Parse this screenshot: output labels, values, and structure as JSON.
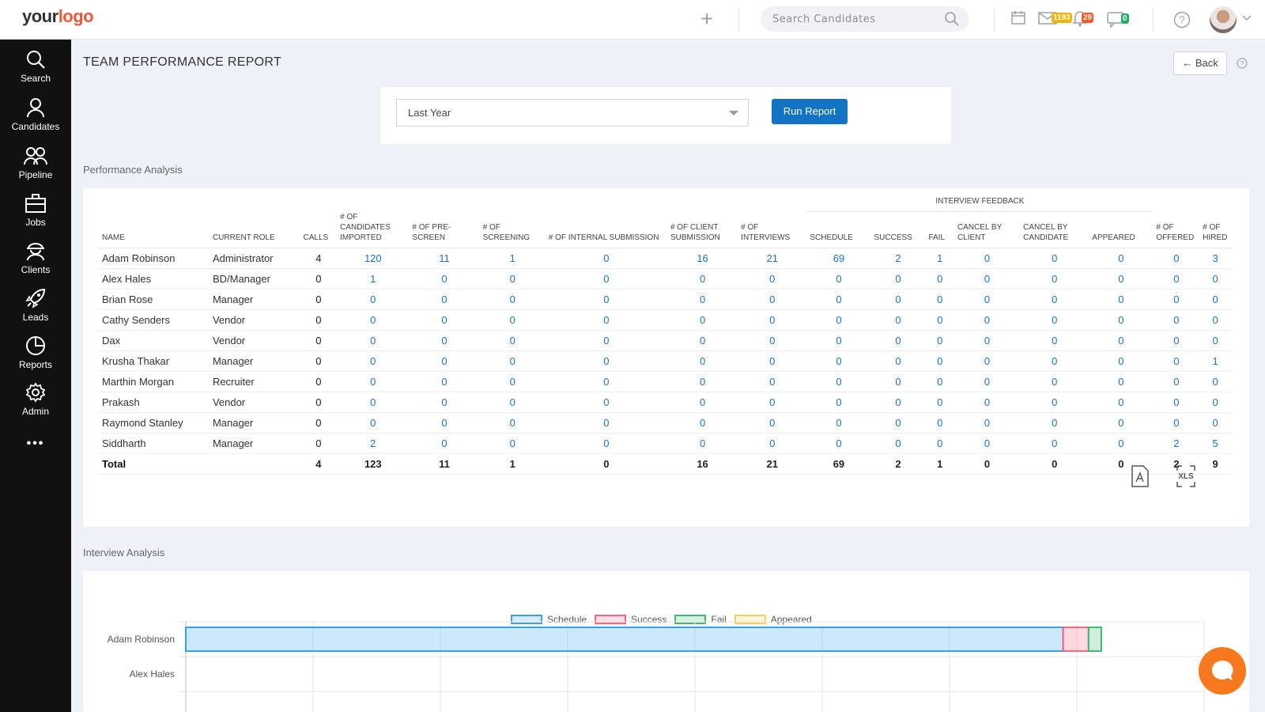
{
  "header": {
    "logo_part1": "your",
    "logo_part2": "logo",
    "search_placeholder": "Search Candidates",
    "mail_badge": "1193",
    "bell_badge": "29",
    "chat_badge": "0",
    "badge_colors": {
      "mail": "#f0b400",
      "bell": "#ff5722",
      "chat": "#27ae60"
    }
  },
  "sidebar": {
    "items": [
      {
        "label": "Search",
        "icon": "search-icon"
      },
      {
        "label": "Candidates",
        "icon": "user-icon"
      },
      {
        "label": "Pipeline",
        "icon": "users-icon"
      },
      {
        "label": "Jobs",
        "icon": "briefcase-icon"
      },
      {
        "label": "Clients",
        "icon": "client-icon"
      },
      {
        "label": "Leads",
        "icon": "rocket-icon"
      },
      {
        "label": "Reports",
        "icon": "pie-chart-icon"
      },
      {
        "label": "Admin",
        "icon": "gear-icon"
      }
    ],
    "more": "•••"
  },
  "page": {
    "title": "TEAM PERFORMANCE REPORT",
    "back_label": "← Back"
  },
  "filter": {
    "period": "Last Year",
    "run_label": "Run Report"
  },
  "performance": {
    "section_label": "Performance Analysis",
    "group_header": "INTERVIEW FEEDBACK",
    "columns": [
      "NAME",
      "CURRENT ROLE",
      "CALLS",
      "# OF CANDIDATES IMPORTED",
      "# OF PRE-SCREEN",
      "# OF SCREENING",
      "# OF INTERNAL SUBMISSION",
      "# OF CLIENT SUBMISSION",
      "# OF INTERVIEWS",
      "SCHEDULE",
      "SUCCESS",
      "FAIL",
      "CANCEL BY CLIENT",
      "CANCEL BY CANDIDATE",
      "APPEARED",
      "# OF OFFERED",
      "# OF HIRED"
    ],
    "rows": [
      [
        "Adam Robinson",
        "Administrator",
        "4",
        "120",
        "11",
        "1",
        "0",
        "16",
        "21",
        "69",
        "2",
        "1",
        "0",
        "0",
        "0",
        "0",
        "3"
      ],
      [
        "Alex Hales",
        "BD/Manager",
        "0",
        "1",
        "0",
        "0",
        "0",
        "0",
        "0",
        "0",
        "0",
        "0",
        "0",
        "0",
        "0",
        "0",
        "0"
      ],
      [
        "Brian Rose",
        "Manager",
        "0",
        "0",
        "0",
        "0",
        "0",
        "0",
        "0",
        "0",
        "0",
        "0",
        "0",
        "0",
        "0",
        "0",
        "0"
      ],
      [
        "Cathy Senders",
        "Vendor",
        "0",
        "0",
        "0",
        "0",
        "0",
        "0",
        "0",
        "0",
        "0",
        "0",
        "0",
        "0",
        "0",
        "0",
        "0"
      ],
      [
        "Dax",
        "Vendor",
        "0",
        "0",
        "0",
        "0",
        "0",
        "0",
        "0",
        "0",
        "0",
        "0",
        "0",
        "0",
        "0",
        "0",
        "0"
      ],
      [
        "Krusha Thakar",
        "Manager",
        "0",
        "0",
        "0",
        "0",
        "0",
        "0",
        "0",
        "0",
        "0",
        "0",
        "0",
        "0",
        "0",
        "0",
        "1"
      ],
      [
        "Marthin Morgan",
        "Recruiter",
        "0",
        "0",
        "0",
        "0",
        "0",
        "0",
        "0",
        "0",
        "0",
        "0",
        "0",
        "0",
        "0",
        "0",
        "0"
      ],
      [
        "Prakash",
        "Vendor",
        "0",
        "0",
        "0",
        "0",
        "0",
        "0",
        "0",
        "0",
        "0",
        "0",
        "0",
        "0",
        "0",
        "0",
        "0"
      ],
      [
        "Raymond Stanley",
        "Manager",
        "0",
        "0",
        "0",
        "0",
        "0",
        "0",
        "0",
        "0",
        "0",
        "0",
        "0",
        "0",
        "0",
        "0",
        "0"
      ],
      [
        "Siddharth",
        "Manager",
        "0",
        "2",
        "0",
        "0",
        "0",
        "0",
        "0",
        "0",
        "0",
        "0",
        "0",
        "0",
        "0",
        "2",
        "5"
      ]
    ],
    "total": [
      "Total",
      "",
      "4",
      "123",
      "11",
      "1",
      "0",
      "16",
      "21",
      "69",
      "2",
      "1",
      "0",
      "0",
      "0",
      "2",
      "9"
    ],
    "export_pdf": "pdf-icon",
    "export_xls": "XLS"
  },
  "interview": {
    "section_label": "Interview Analysis",
    "chart_data": {
      "type": "bar",
      "orientation": "horizontal",
      "stacked": true,
      "categories": [
        "Adam Robinson",
        "Alex Hales"
      ],
      "series": [
        {
          "name": "Schedule",
          "values": [
            69,
            0
          ],
          "color": "#36a2eb"
        },
        {
          "name": "Success",
          "values": [
            2,
            0
          ],
          "color": "#ff6384"
        },
        {
          "name": "Fail",
          "values": [
            1,
            0
          ],
          "color": "#3cba6f"
        },
        {
          "name": "Appeared",
          "values": [
            0,
            0
          ],
          "color": "#ffcd56"
        }
      ],
      "legend": "top",
      "grid": true
    }
  }
}
